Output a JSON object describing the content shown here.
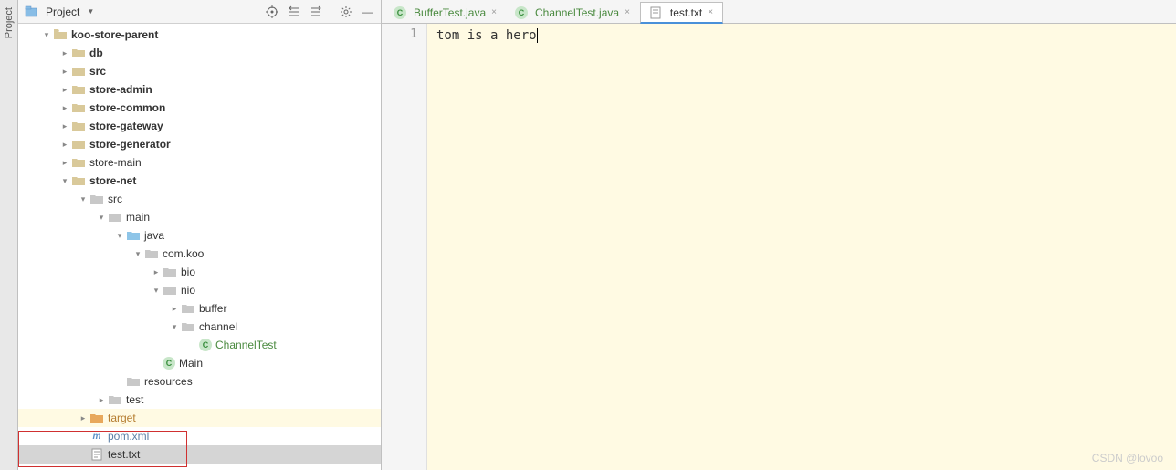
{
  "side_tab": {
    "label": "Project"
  },
  "panel": {
    "title": "Project",
    "toolbar_icons": [
      "locate",
      "expand",
      "collapse",
      "settings"
    ]
  },
  "tree": {
    "root": {
      "label": "koo-store-parent",
      "children": [
        {
          "label": "db",
          "bold": true
        },
        {
          "label": "src",
          "bold": true
        },
        {
          "label": "store-admin",
          "bold": true
        },
        {
          "label": "store-common",
          "bold": true
        },
        {
          "label": "store-gateway",
          "bold": true
        },
        {
          "label": "store-generator",
          "bold": true
        },
        {
          "label": "store-main",
          "bold": false
        },
        {
          "label": "store-net",
          "bold": true
        }
      ]
    },
    "store_net": {
      "src": "src",
      "main": "main",
      "java": "java",
      "pkg": "com.koo",
      "bio": "bio",
      "nio": "nio",
      "buffer": "buffer",
      "channel": "channel",
      "channel_test": "ChannelTest",
      "main_class": "Main",
      "resources": "resources",
      "test": "test",
      "target": "target",
      "pom": "pom.xml",
      "testtxt": "test.txt"
    }
  },
  "tabs": [
    {
      "label": "BufferTest.java",
      "icon": "java",
      "active": false,
      "green": true
    },
    {
      "label": "ChannelTest.java",
      "icon": "java",
      "active": false,
      "green": true
    },
    {
      "label": "test.txt",
      "icon": "txt",
      "active": true,
      "green": false
    }
  ],
  "editor": {
    "line_number": "1",
    "content": "tom is a hero"
  },
  "watermark": "CSDN @lovoo"
}
